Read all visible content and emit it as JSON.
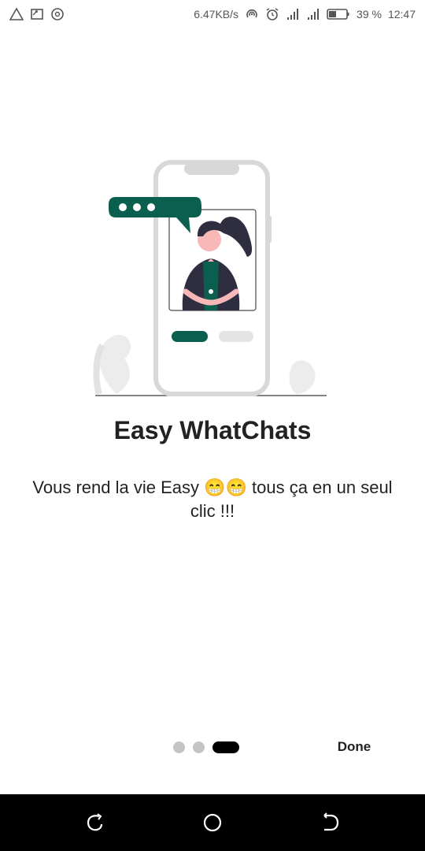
{
  "status_bar": {
    "left_icons": [
      "warning-icon",
      "cast-icon",
      "record-icon"
    ],
    "speed": "6.47KB/s",
    "battery_percent": "39 %",
    "time": "12:47",
    "right_icons": [
      "hotspot-icon",
      "alarm-icon",
      "signal-icon",
      "signal-icon",
      "battery-icon"
    ]
  },
  "onboarding": {
    "title": "Easy WhatChats",
    "description": "Vous rend la vie Easy 😁😁 tous ça en un seul clic !!!",
    "page_index": 3,
    "page_count": 3,
    "done_label": "Done",
    "accent_color": "#0b5f4f"
  },
  "nav_bar": {
    "buttons": [
      "recents-icon",
      "home-icon",
      "back-icon"
    ]
  }
}
